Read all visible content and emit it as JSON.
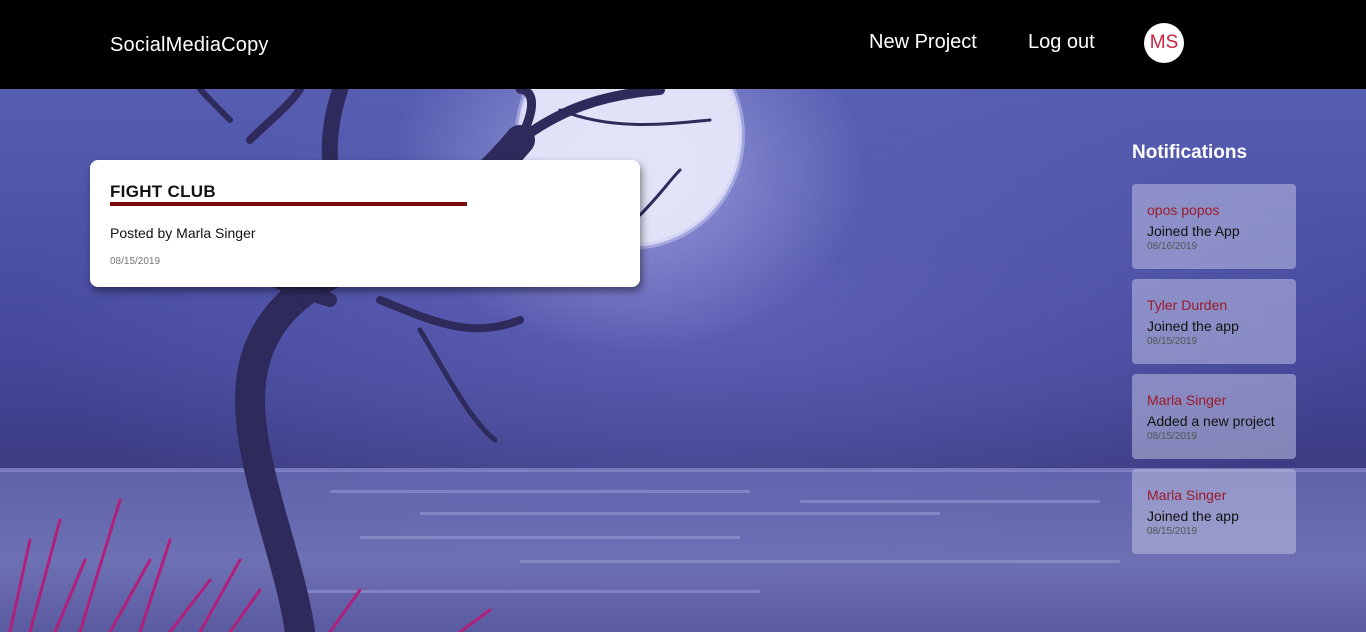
{
  "header": {
    "brand": "SocialMediaCopy",
    "new_project": "New Project",
    "log_out": "Log out",
    "avatar_initials": "MS"
  },
  "project": {
    "title": "FIGHT CLUB",
    "author": "Posted by Marla Singer",
    "date": "08/15/2019"
  },
  "notifications": {
    "heading": "Notifications",
    "items": [
      {
        "name": "opos popos",
        "message": "Joined the App",
        "date": "08/16/2019"
      },
      {
        "name": "Tyler Durden",
        "message": "Joined the app",
        "date": "08/15/2019"
      },
      {
        "name": "Marla Singer",
        "message": "Added a new project",
        "date": "08/15/2019"
      },
      {
        "name": "Marla Singer",
        "message": "Joined the app",
        "date": "08/15/2019"
      }
    ]
  },
  "colors": {
    "header_bg": "#000000",
    "accent": "#9b1a2a",
    "title_rule": "#7a0b0b",
    "avatar_text": "#c8233f"
  }
}
